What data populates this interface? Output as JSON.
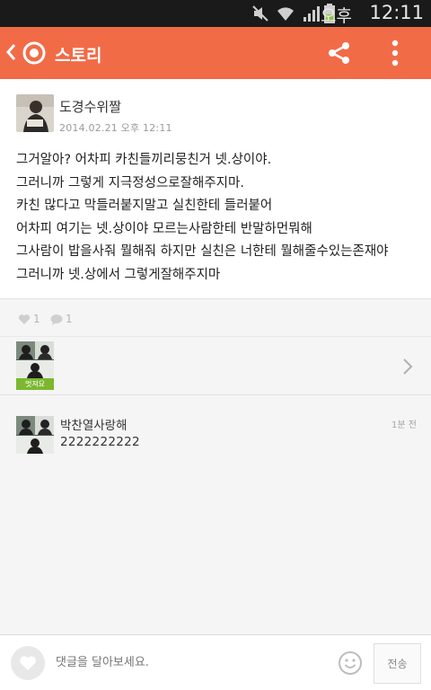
{
  "status_bar": {
    "ampm": "오후",
    "time": "12:11",
    "icons": [
      "mute-icon",
      "wifi-icon",
      "signal-icon",
      "battery-icon"
    ]
  },
  "app_bar": {
    "title": "스토리",
    "icons": [
      "back-icon",
      "story-logo-icon",
      "share-icon",
      "more-icon"
    ],
    "color": "#f26b47"
  },
  "post": {
    "author": "도경수위짤",
    "date": "2014.02.21 오후 12:11",
    "lines": [
      "그거알아? 어차피 카친들끼리뭉친거 넷.상이야.",
      "그러니까 그렇게 지극정성으로잘해주지마.",
      "카친 많다고 막들러붙지말고 실친한테 들러붙어",
      "어차피 여기는 넷.상이야 모르는사람한테 반말하먼뭐해",
      "그사람이 밥을사줘 뭘해줘 하지만 실친은 너한테 뭘해줄수있는존재야",
      "그러니까 넷.상에서 그렇게잘해주지마"
    ]
  },
  "reactions": {
    "likes": "1",
    "comments": "1"
  },
  "likers": {
    "tag_label": "멋져요"
  },
  "comments": [
    {
      "author": "박찬열사랑해",
      "text": "2222222222",
      "time": "1분 전"
    }
  ],
  "input_bar": {
    "placeholder": "댓글을 달아보세요.",
    "send_label": "전송"
  }
}
